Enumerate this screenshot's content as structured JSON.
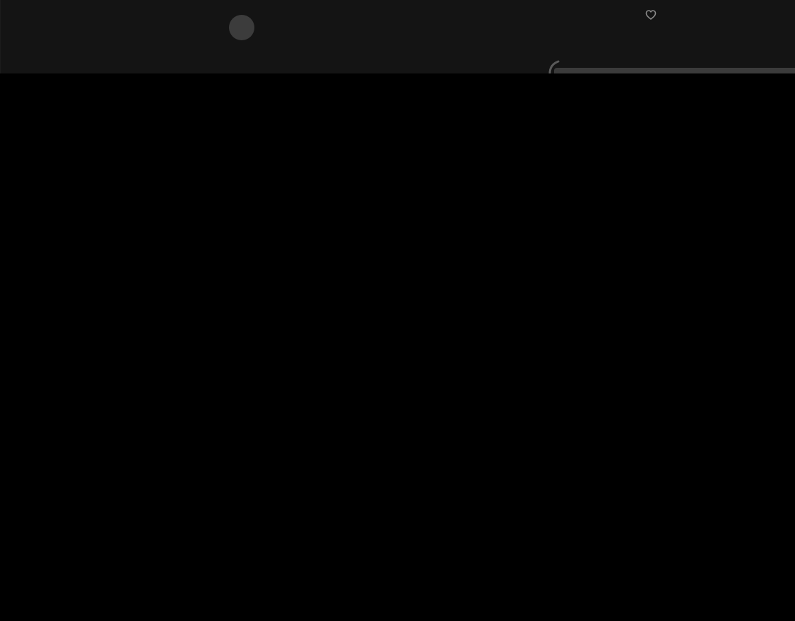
{
  "header": {
    "avatar_icon": "avatar-icon",
    "favorite_icon": "heart-icon"
  },
  "panel": {
    "handle_icon": "panel-corner-icon"
  },
  "colors": {
    "background": "#000000",
    "top_bar": "#141414",
    "avatar": "#3c3c3c",
    "icon_stroke": "#8a8a8a",
    "panel_edge": "#3b3b3b"
  }
}
